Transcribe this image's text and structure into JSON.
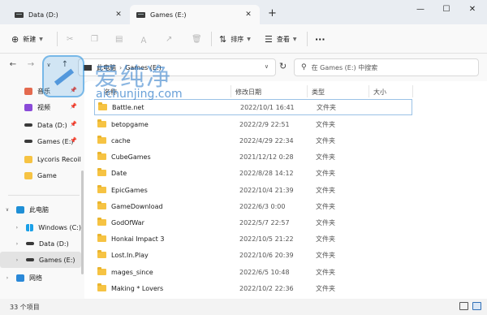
{
  "tabs": [
    {
      "label": "Data (D:)"
    },
    {
      "label": "Games (E:)"
    }
  ],
  "window": {
    "minimize": "—",
    "maximize": "☐",
    "close": "✕",
    "new_tab": "+"
  },
  "toolbar": {
    "new_label": "新建",
    "sort_label": "排序",
    "view_label": "查看",
    "more_label": "···"
  },
  "address": {
    "crumbs": [
      "此电脑",
      "Games (E:)"
    ],
    "search_placeholder": "在 Games (E:) 中搜索"
  },
  "sidebar": {
    "items": [
      {
        "label": "音乐",
        "icon": "music-icon",
        "pinned": true
      },
      {
        "label": "视频",
        "icon": "video-icon",
        "pinned": true
      },
      {
        "label": "Data (D:)",
        "icon": "drive-icon",
        "pinned": true
      },
      {
        "label": "Games (E:)",
        "icon": "drive-icon",
        "pinned": true
      },
      {
        "label": "Lycoris Recoil",
        "icon": "folder-icon",
        "pinned": false
      },
      {
        "label": "Game",
        "icon": "folder-icon",
        "pinned": false
      }
    ],
    "tree": [
      {
        "label": "此电脑",
        "icon": "monitor-icon",
        "expanded": true
      },
      {
        "label": "Windows (C:)",
        "icon": "windows-drive-icon"
      },
      {
        "label": "Data (D:)",
        "icon": "drive-icon"
      },
      {
        "label": "Games (E:)",
        "icon": "drive-icon",
        "selected": true
      },
      {
        "label": "网络",
        "icon": "network-icon"
      }
    ]
  },
  "columns": [
    "名称",
    "修改日期",
    "类型",
    "大小"
  ],
  "files": [
    {
      "name": "Battle.net",
      "date": "2022/10/1 16:41",
      "type": "文件夹"
    },
    {
      "name": "betopgame",
      "date": "2022/2/9 22:51",
      "type": "文件夹"
    },
    {
      "name": "cache",
      "date": "2022/4/29 22:34",
      "type": "文件夹"
    },
    {
      "name": "CubeGames",
      "date": "2021/12/12 0:28",
      "type": "文件夹"
    },
    {
      "name": "Date",
      "date": "2022/8/28 14:12",
      "type": "文件夹"
    },
    {
      "name": "EpicGames",
      "date": "2022/10/4 21:39",
      "type": "文件夹"
    },
    {
      "name": "GameDownload",
      "date": "2022/6/3 0:00",
      "type": "文件夹"
    },
    {
      "name": "GodOfWar",
      "date": "2022/5/7 22:57",
      "type": "文件夹"
    },
    {
      "name": "Honkai Impact 3",
      "date": "2022/10/5 21:22",
      "type": "文件夹"
    },
    {
      "name": "Lost.In.Play",
      "date": "2022/10/6 20:39",
      "type": "文件夹"
    },
    {
      "name": "mages_since",
      "date": "2022/6/5 10:48",
      "type": "文件夹"
    },
    {
      "name": "Making * Lovers",
      "date": "2022/10/2 22:36",
      "type": "文件夹"
    }
  ],
  "watermark": {
    "cn": "爱纯净",
    "en": "aichunjing.com"
  },
  "status": {
    "count": "33 个项目"
  },
  "colors": {
    "folder": "#f6c343",
    "accent": "#2f6fb7",
    "titlebar": "#e9edf2"
  }
}
